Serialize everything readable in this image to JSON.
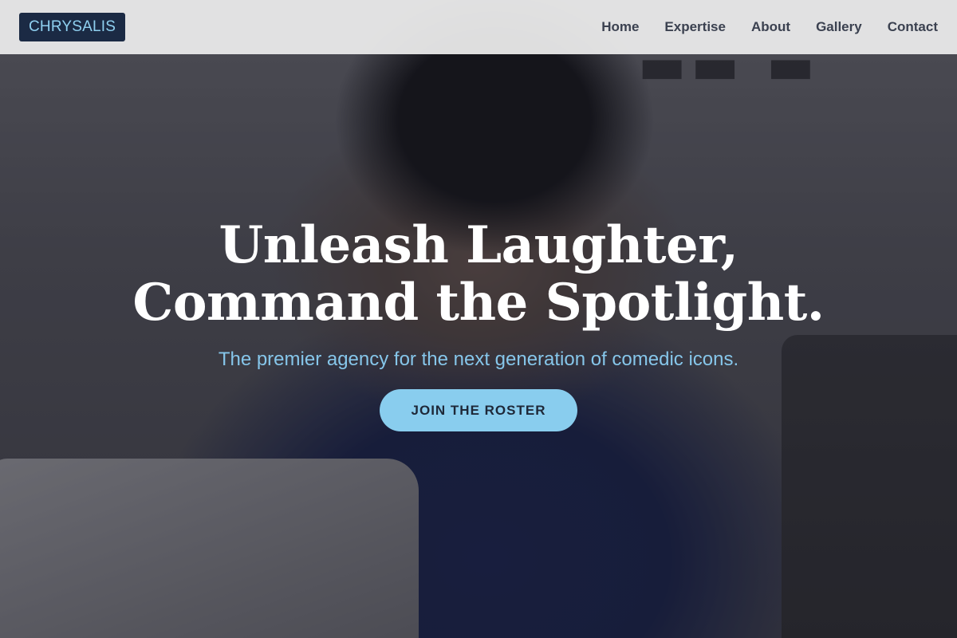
{
  "header": {
    "logo_text": "CHRYSALIS",
    "nav": [
      {
        "label": "Home"
      },
      {
        "label": "Expertise"
      },
      {
        "label": "About"
      },
      {
        "label": "Gallery"
      },
      {
        "label": "Contact"
      }
    ]
  },
  "hero": {
    "title_line1": "Unleash Laughter,",
    "title_line2": "Command the Spotlight.",
    "subtitle": "The premier agency for the next generation of comedic icons.",
    "cta_label": "JOIN THE ROSTER"
  },
  "colors": {
    "header_bg": "#ebebeb",
    "logo_bg": "#1b2a44",
    "logo_text": "#8fd0f0",
    "nav_text": "#3b4150",
    "accent": "#89cdee",
    "subtitle": "#86c6ea",
    "title": "#ffffff"
  }
}
